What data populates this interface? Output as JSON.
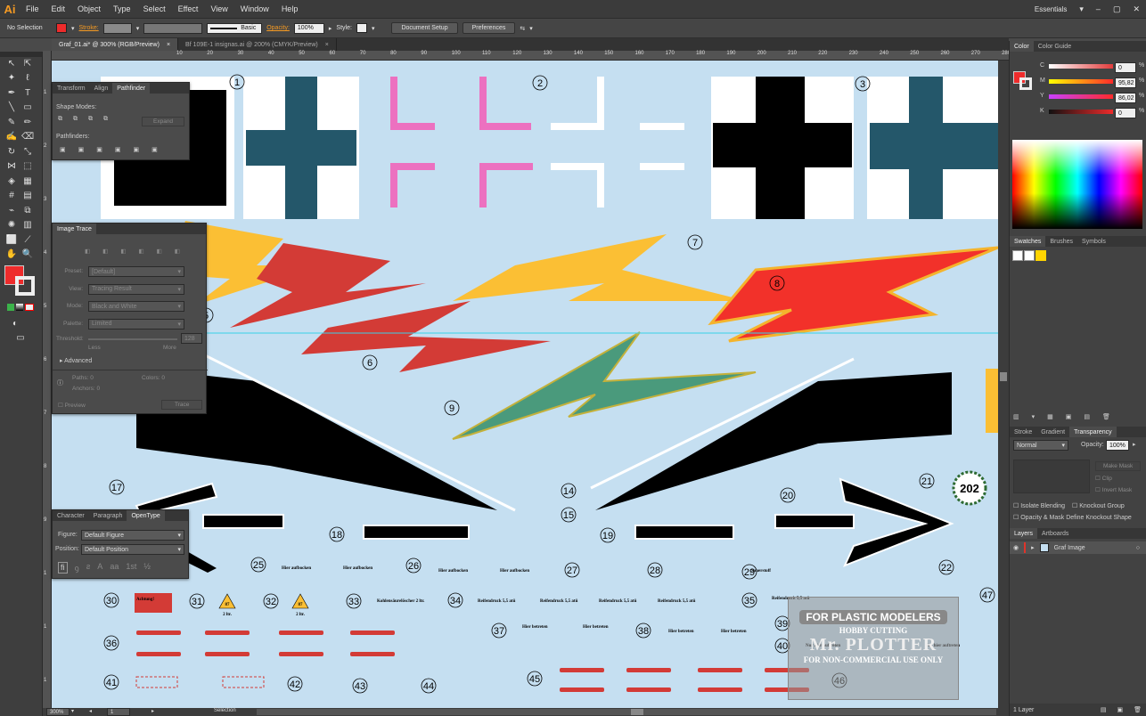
{
  "app": {
    "logo": "Ai",
    "workspace": "Essentials"
  },
  "menu": [
    "File",
    "Edit",
    "Object",
    "Type",
    "Select",
    "Effect",
    "View",
    "Window",
    "Help"
  ],
  "control_bar": {
    "selection": "No Selection",
    "stroke_label": "Stroke:",
    "brush": "Basic",
    "opacity_label": "Opacity:",
    "opacity_value": "100%",
    "style_label": "Style:",
    "doc_setup": "Document Setup",
    "preferences": "Preferences"
  },
  "doc_tabs": [
    {
      "label": "Graf_01.ai* @ 300% (RGB/Preview)",
      "close": "×"
    },
    {
      "label": "Bf 109E-1 insignas.ai @ 200% (CMYK/Preview)",
      "close": "×"
    }
  ],
  "ruler_h": [
    "10",
    "20",
    "30",
    "40",
    "50",
    "60",
    "70",
    "80",
    "90",
    "100",
    "110",
    "120",
    "130",
    "140",
    "150",
    "160",
    "170",
    "180",
    "190",
    "200",
    "210",
    "220",
    "230",
    "240",
    "250",
    "260",
    "270",
    "280",
    "290",
    "300",
    "310"
  ],
  "ruler_v": [
    "1",
    "2",
    "3",
    "4",
    "5",
    "6",
    "7",
    "8",
    "9",
    "1",
    "1",
    "1"
  ],
  "pathfinder": {
    "tabs": [
      "Transform",
      "Align",
      "Pathfinder"
    ],
    "shape_modes": "Shape Modes:",
    "expand": "Expand",
    "pathfinders": "Pathfinders:"
  },
  "image_trace": {
    "title": "Image Trace",
    "preset_label": "Preset:",
    "preset": "[Default]",
    "view_label": "View:",
    "view": "Tracing Result",
    "mode_label": "Mode:",
    "mode": "Black and White",
    "palette_label": "Palette:",
    "palette": "Limited",
    "threshold_label": "Threshold:",
    "threshold": "128",
    "less": "Less",
    "more": "More",
    "advanced": "Advanced",
    "paths_label": "Paths:",
    "paths": "0",
    "colors_label": "Colors:",
    "colors": "0",
    "anchors_label": "Anchors:",
    "anchors": "0",
    "preview": "Preview",
    "trace": "Trace"
  },
  "character": {
    "tabs": [
      "Character",
      "Paragraph",
      "OpenType"
    ],
    "figure_label": "Figure:",
    "figure": "Default Figure",
    "position_label": "Position:",
    "position": "Default Position",
    "glyphs": [
      "fi",
      "ꝯ",
      "ƨ",
      "A",
      "aa",
      "1st",
      "½"
    ]
  },
  "color_panel": {
    "tabs": [
      "Color",
      "Color Guide"
    ],
    "channels": [
      {
        "name": "C",
        "value": "0",
        "unit": "%"
      },
      {
        "name": "M",
        "value": "95,82",
        "unit": "%"
      },
      {
        "name": "Y",
        "value": "86,02",
        "unit": "%"
      },
      {
        "name": "K",
        "value": "0",
        "unit": "%"
      }
    ]
  },
  "swatches_panel": {
    "tabs": [
      "Swatches",
      "Brushes",
      "Symbols"
    ]
  },
  "transparency_panel": {
    "tabs": [
      "Stroke",
      "Gradient",
      "Transparency"
    ],
    "mode": "Normal",
    "opacity_label": "Opacity:",
    "opacity": "100%",
    "make_mask": "Make Mask",
    "clip": "Clip",
    "invert_mask": "Invert Mask",
    "isolate_blending": "Isolate Blending",
    "knockout_group": "Knockout Group",
    "opacity_mask": "Opacity & Mask Define Knockout Shape"
  },
  "layers_panel": {
    "tabs": [
      "Layers",
      "Artboards"
    ],
    "layer": "Graf Image",
    "footer": "1 Layer"
  },
  "status": {
    "zoom": "300%",
    "page": "1",
    "tool": "Selection"
  },
  "artwork": {
    "numbers": [
      "1",
      "2",
      "3",
      "6",
      "7",
      "8",
      "9",
      "14",
      "15",
      "17",
      "18",
      "19",
      "20",
      "21",
      "22",
      "25",
      "26",
      "27",
      "28",
      "29",
      "30",
      "31",
      "32",
      "33",
      "34",
      "35",
      "36",
      "37",
      "38",
      "39",
      "40",
      "41",
      "42",
      "43",
      "44",
      "45",
      "46",
      "47",
      "5"
    ],
    "stencils": {
      "hier_aufbocken": "Hier aufbocken",
      "achtung": "Achtung!",
      "kohlensaure": "Kohlensäurelöscher 2 ltr.",
      "reifendruck": "Reifendruck 5,5 atü",
      "hier_betreten": "Nicht betreten",
      "sauerstoff": "Sauerstoff",
      "hier_betreten2": "Hier betreten",
      "fuel": "87",
      "fuel_sub": "2 ltr.",
      "laurel": "202",
      "hier_auftreten": "Nur hier auftreten"
    },
    "watermark": {
      "line1": "FOR PLASTIC MODELERS",
      "line2": "HOBBY CUTTING",
      "line3": "Mr. PLOTTER",
      "line4": "FOR NON-COMMERCIAL USE ONLY"
    }
  },
  "colors": {
    "accent_red": "#ee2b2b",
    "teal_cross": "#24576a",
    "pink_cross": "#ec71c0",
    "yellow": "#fbbf34",
    "decal_red": "#d33b36",
    "green_bolt": "#4a9a7c",
    "canvas_bg": "#c5dff1"
  }
}
